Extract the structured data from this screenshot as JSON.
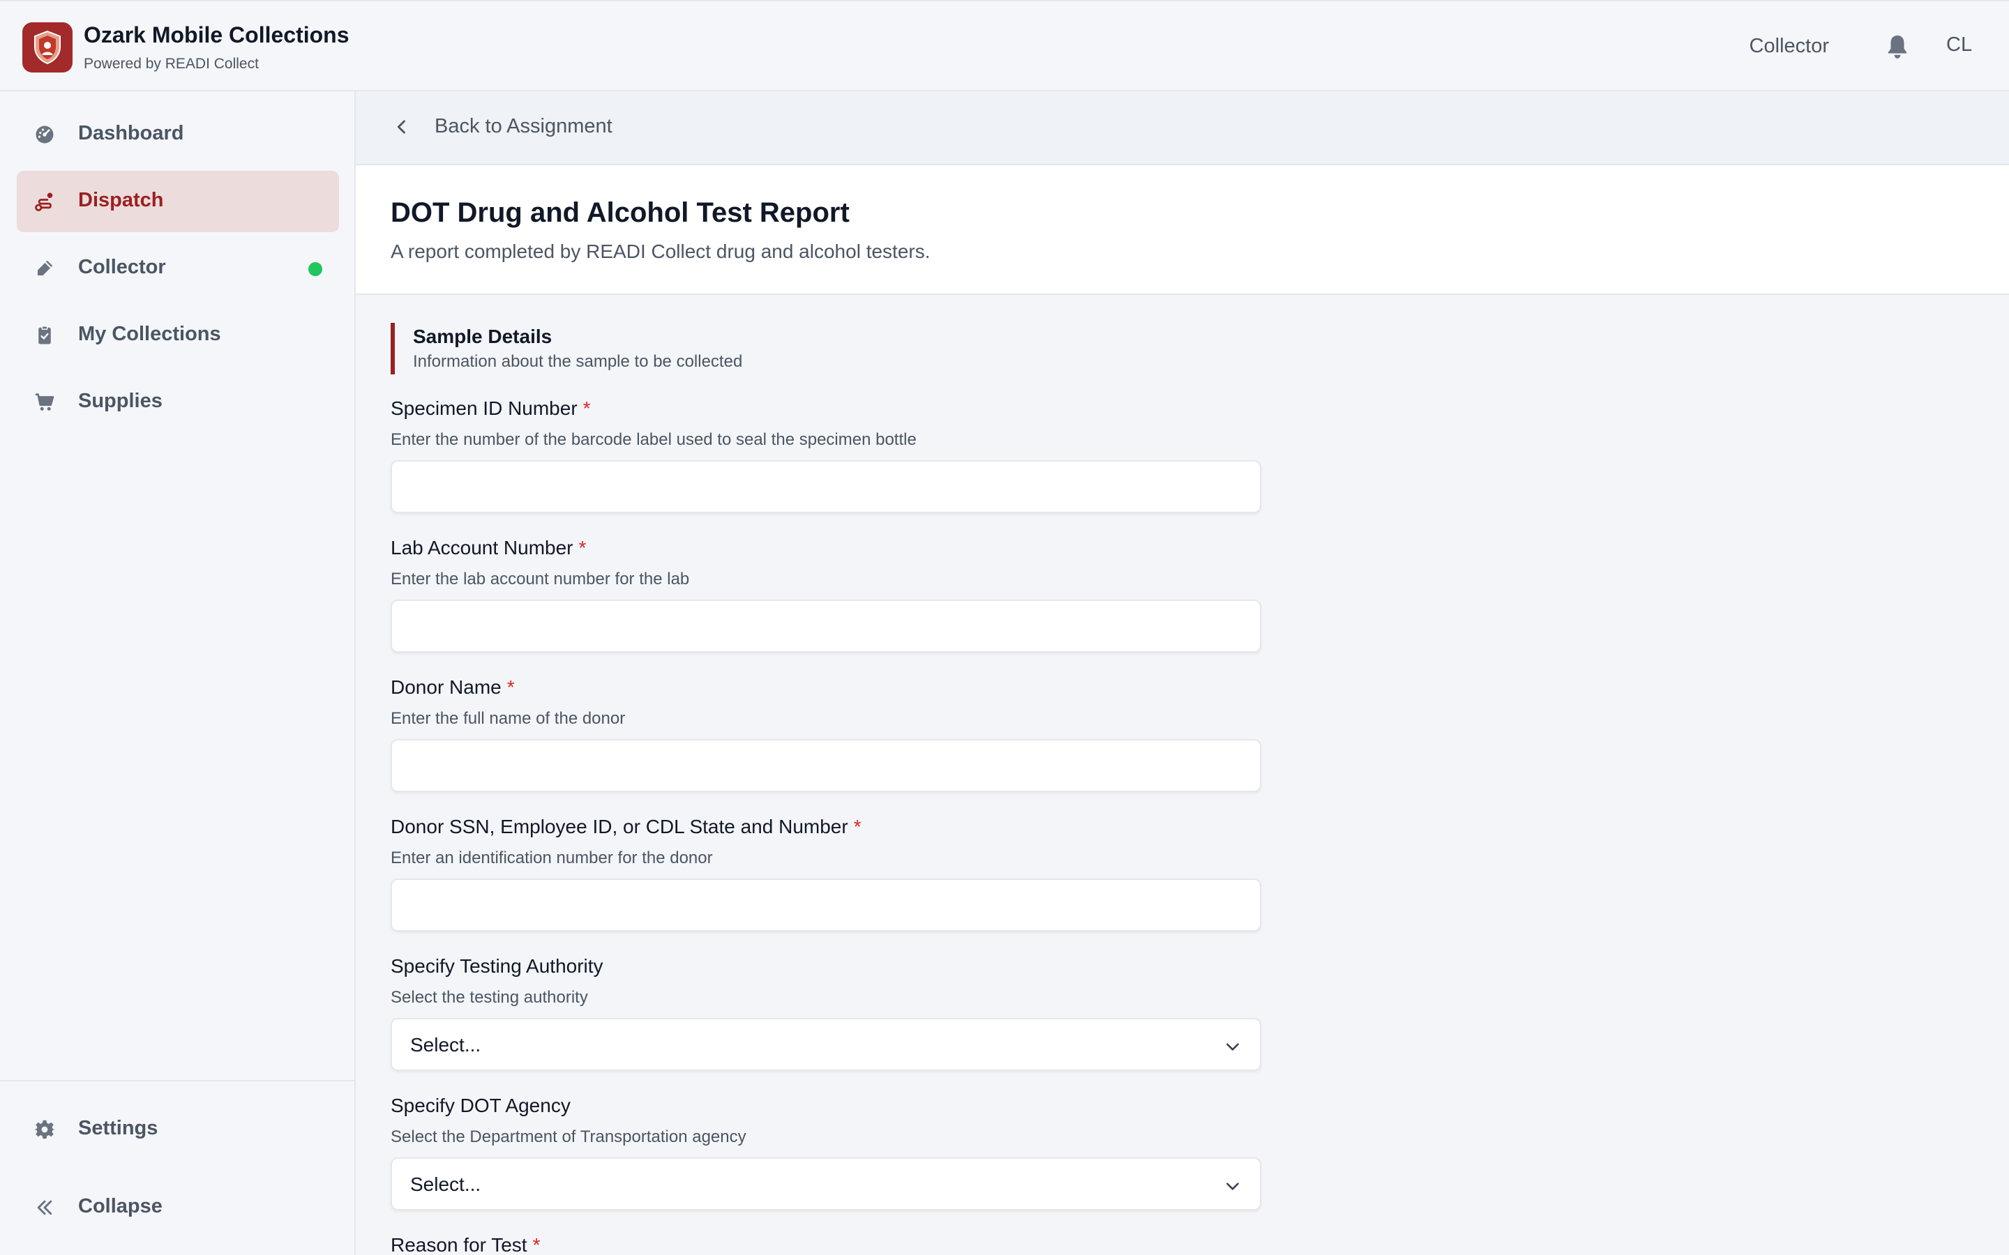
{
  "header": {
    "app_title": "Ozark Mobile Collections",
    "app_subtitle": "Powered by READI Collect",
    "role": "Collector",
    "user_initials": "CL",
    "icons": {
      "logo": "shield-logo-icon",
      "notifications": "bell-icon"
    }
  },
  "sidebar": {
    "items": [
      {
        "label": "Dashboard",
        "icon": "dashboard-gauge-icon"
      },
      {
        "label": "Dispatch",
        "icon": "route-icon"
      },
      {
        "label": "Collector",
        "icon": "pen-icon"
      },
      {
        "label": "My Collections",
        "icon": "clipboard-check-icon"
      },
      {
        "label": "Supplies",
        "icon": "cart-icon"
      }
    ],
    "footer": [
      {
        "label": "Settings",
        "icon": "gear-icon"
      },
      {
        "label": "Collapse",
        "icon": "double-chevron-left-icon"
      }
    ]
  },
  "main": {
    "back_label": "Back to Assignment",
    "title": "DOT Drug and Alcohol Test Report",
    "subtitle": "A report completed by READI Collect drug and alcohol testers.",
    "section": {
      "title": "Sample Details",
      "description": "Information about the sample to be collected"
    },
    "fields": [
      {
        "label": "Specimen ID Number",
        "required": "*",
        "help": "Enter the number of the barcode label used to seal the specimen bottle",
        "value": ""
      },
      {
        "label": "Lab Account Number",
        "required": "*",
        "help": "Enter the lab account number for the lab",
        "value": ""
      },
      {
        "label": "Donor Name",
        "required": "*",
        "help": "Enter the full name of the donor",
        "value": ""
      },
      {
        "label": "Donor SSN, Employee ID, or CDL State and Number",
        "required": "*",
        "help": "Enter an identification number for the donor",
        "value": ""
      },
      {
        "label": "Specify Testing Authority",
        "help": "Select the testing authority",
        "selected": "Select..."
      },
      {
        "label": "Specify DOT Agency",
        "help": "Select the Department of Transportation agency",
        "selected": "Select..."
      },
      {
        "label": "Reason for Test",
        "required": "*"
      }
    ]
  },
  "colors": {
    "accent": "#9b2020",
    "active_bg": "#ecdcdc",
    "status_online": "#22c55e",
    "required": "#dc2626"
  }
}
